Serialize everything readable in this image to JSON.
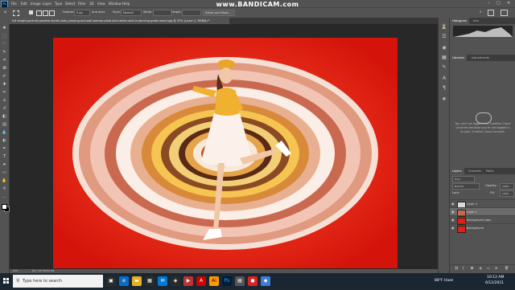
{
  "app": {
    "logo": "Ps"
  },
  "watermark": "www.BANDICAM.com",
  "menu": [
    "File",
    "Edit",
    "Image",
    "Layer",
    "Type",
    "Select",
    "Filter",
    "3D",
    "View",
    "Window",
    "Help"
  ],
  "window_controls": {
    "minimize": "–",
    "maximize": "□",
    "close": "✕"
  },
  "options": {
    "feather_label": "Feather:",
    "feather_value": "0 px",
    "antialias_label": "Anti-alias",
    "style_label": "Style:",
    "style_value": "Normal",
    "width_label": "Width:",
    "height_label": "Height:",
    "select_mask_button": "Select and Mask..."
  },
  "document": {
    "tab_title": "full-length-portrait-positive-stylish-lady-jumping-out-wall-woman-plaid-shirt-white-skirt-is-dancing-great-mood.jpg @ 25% (Layer 2, RGB/8) *",
    "zoom": "25%",
    "doc_info": "Doc: 24.7M/52.3M"
  },
  "panels": {
    "histogram": {
      "tabs": [
        "Histogram",
        "Info"
      ]
    },
    "libraries": {
      "tabs": [
        "Libraries",
        "Adjustments"
      ],
      "message": "You can't be logged into Creative Cloud Libraries because you're not logged in to your Creative Cloud account."
    },
    "layers": {
      "tabs": [
        "Layers",
        "Channels",
        "Paths"
      ],
      "kind_label": "Kind",
      "blend_mode": "Normal",
      "opacity_label": "Opacity:",
      "opacity_value": "100%",
      "lock_label": "Lock:",
      "fill_label": "Fill:",
      "fill_value": "100%",
      "rows": [
        {
          "name": "Layer 2"
        },
        {
          "name": "Layer 1"
        },
        {
          "name": "Background copy"
        },
        {
          "name": "Background"
        }
      ]
    }
  },
  "taskbar": {
    "search_placeholder": "Type here to search",
    "weather": "88°F  Haze",
    "time": "10:12 AM",
    "date": "6/12/2021"
  },
  "colors": {
    "canvas_red": "#e11f12",
    "ui_panel": "#535353",
    "taskbar": "#1b2633",
    "accent_blue": "#31a8ff"
  },
  "icons": [
    "photoshop-logo",
    "move-tool-icon",
    "marquee-tool-icon",
    "lasso-tool-icon",
    "quick-select-tool-icon",
    "crop-tool-icon",
    "eyedropper-tool-icon",
    "healing-tool-icon",
    "brush-tool-icon",
    "stamp-tool-icon",
    "history-brush-icon",
    "eraser-tool-icon",
    "gradient-tool-icon",
    "blur-tool-icon",
    "dodge-tool-icon",
    "pen-tool-icon",
    "type-tool-icon",
    "path-select-icon",
    "shape-tool-icon",
    "hand-tool-icon",
    "zoom-tool-icon",
    "windows-logo-icon",
    "search-icon"
  ]
}
